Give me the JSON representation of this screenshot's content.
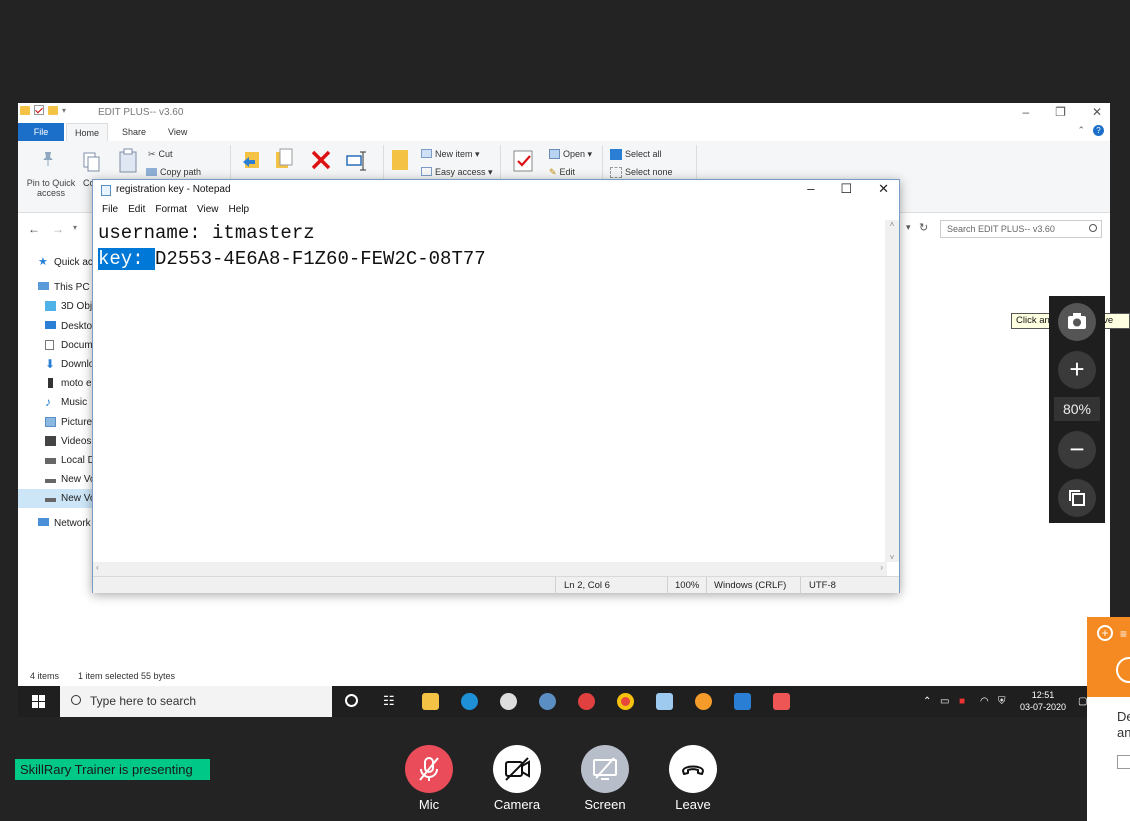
{
  "explorer": {
    "title": "EDIT PLUS-- v3.60",
    "window_controls": [
      "–",
      "❐",
      "✕"
    ],
    "tabs": {
      "file": "File",
      "home": "Home",
      "share": "Share",
      "view": "View"
    },
    "ribbon": {
      "pin_label_1": "Pin to Quick",
      "pin_label_2": "access",
      "copy_short": "Co",
      "cut": "Cut",
      "copy_path": "Copy path",
      "new_item": "New item ▾",
      "easy_access": "Easy access ▾",
      "open": "Open ▾",
      "edit": "Edit",
      "select_all": "Select all",
      "select_none": "Select none"
    },
    "search_placeholder": "Search EDIT PLUS-- v3.60",
    "nav": {
      "quick_access": "Quick ac",
      "this_pc": "This PC",
      "objects_3d": "3D Obje",
      "desktop": "Deskto",
      "documents": "Docum",
      "downloads": "Downlo",
      "moto": "moto e",
      "music": "Music",
      "pictures": "Picture",
      "videos": "Videos",
      "local_disk": "Local D",
      "new_volume_1": "New Vo",
      "new_volume_2": "New Vo",
      "network": "Network"
    },
    "status": {
      "items": "4 items",
      "selected": "1 item selected  55 bytes"
    }
  },
  "notepad": {
    "title": "registration key - Notepad",
    "menu": [
      "File",
      "Edit",
      "Format",
      "View",
      "Help"
    ],
    "line1": "username: itmasterz",
    "line2_selected": "key: ",
    "line2_rest": "D2553-4E6A8-F1Z60-FEW2C-08T77",
    "status": {
      "position": "Ln 2, Col 6",
      "zoom": "100%",
      "line_ending": "Windows (CRLF)",
      "encoding": "UTF-8"
    }
  },
  "taskbar": {
    "search_placeholder": "Type here to search",
    "time": "12:51",
    "date": "03-07-2020"
  },
  "zoom_panel": {
    "percent": "80%"
  },
  "tooltip": "Click and drag to move",
  "side_popup": {
    "text_1": "De",
    "text_2": "an"
  },
  "meeting": {
    "presenting": "SkillRary Trainer is presenting",
    "mic": "Mic",
    "camera": "Camera",
    "screen": "Screen",
    "leave": "Leave"
  }
}
